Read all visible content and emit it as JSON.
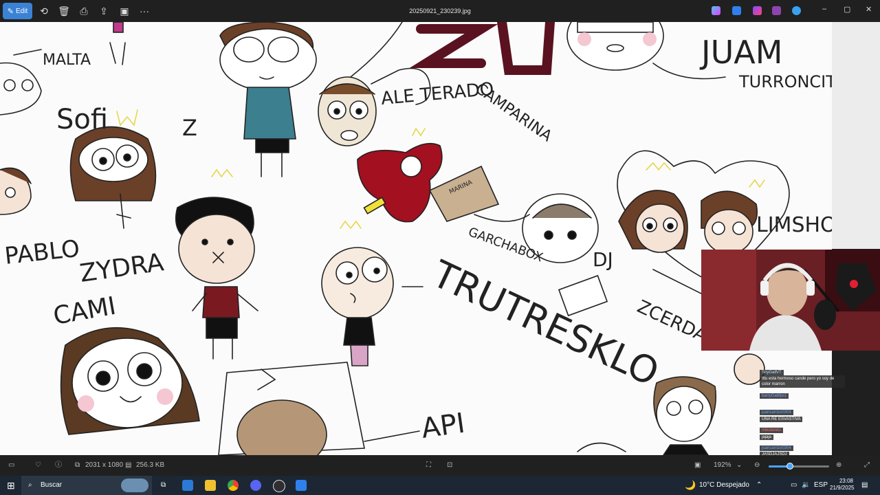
{
  "toolbar": {
    "edit_label": "Edit",
    "file_title": "20250921_230239.jpg",
    "more_label": "···"
  },
  "window_controls": {
    "minimize": "–",
    "maximize": "▢",
    "close": "✕"
  },
  "drawing_labels": {
    "malta": "MALTA",
    "sofi": "Sofi",
    "z_mark": "Z",
    "zu": "ZU",
    "ale_terado": "ALE TERADO",
    "campa_rina": "CAMPARINA",
    "juam": "JUAM",
    "turroncito": "TURRONCITO",
    "marina": "MARINA",
    "garchabox": "GARCHABOX",
    "dj": "DJ",
    "pablo": "PABLO",
    "zydra": "ZYDRA",
    "cami": "CAMI",
    "trutres_klo": "TRUTRESKLO",
    "api": "API",
    "zcerda": "ZCERDA",
    "limsho": "LIMSHO"
  },
  "chat": {
    "messages": [
      {
        "user": "ShyGallVT",
        "text": "tttu esta hermoso cande pero yo soy de color marron"
      },
      {
        "user": "barryGabfps1",
        "text": ""
      },
      {
        "user": "juancarrizo0304",
        "text": "UNA RE ESVASTIVA"
      },
      {
        "user": "mikutendo",
        "text": "jajaja"
      },
      {
        "user": "juancarrizo0304",
        "text": "JASDJAJSDJ"
      }
    ]
  },
  "status": {
    "dimensions": "2031 x 1080",
    "file_size": "256.3 KB",
    "zoom": "192%",
    "zoom_fraction": 0.35
  },
  "taskbar": {
    "search_placeholder": "Buscar",
    "weather": "10°C  Despejado",
    "language": "ESP",
    "time": "23:08",
    "date": "21/9/2025"
  },
  "colors": {
    "accent": "#3b82d4",
    "toolbar_bg": "#202020",
    "taskbar_bg": "#1c2733",
    "canvas_bg": "#fbfbfb"
  }
}
